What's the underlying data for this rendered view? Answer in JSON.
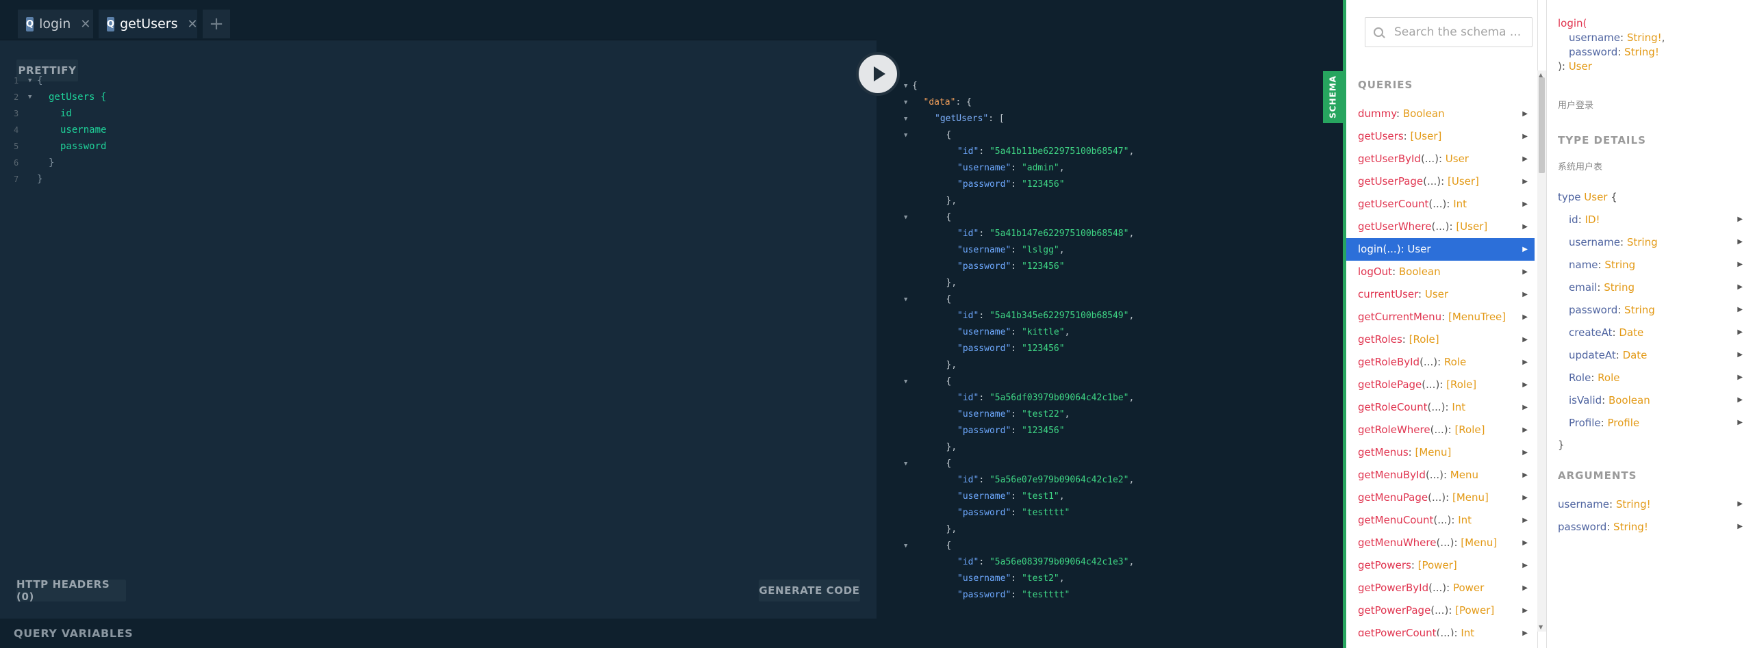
{
  "tabs": [
    {
      "icon": "Q",
      "label": "login",
      "close": "✕"
    },
    {
      "icon": "Q",
      "label": "getUsers",
      "close": "✕"
    }
  ],
  "add_tab": "+",
  "toolbar": {
    "prettify": "PRETTIFY",
    "http_headers": "HTTP HEADERS (0)",
    "generate_code": "GENERATE CODE"
  },
  "query_variables": "QUERY VARIABLES",
  "schema_tab": "SCHEMA",
  "editor": [
    {
      "n": "1",
      "fold": true,
      "text": "{",
      "indent": 0,
      "cls": "punc"
    },
    {
      "n": "2",
      "fold": true,
      "text": "getUsers {",
      "indent": 1,
      "cls": "kw-field"
    },
    {
      "n": "3",
      "fold": false,
      "text": "id",
      "indent": 2,
      "cls": "kw-field"
    },
    {
      "n": "4",
      "fold": false,
      "text": "username",
      "indent": 2,
      "cls": "kw-field"
    },
    {
      "n": "5",
      "fold": false,
      "text": "password",
      "indent": 2,
      "cls": "kw-field"
    },
    {
      "n": "6",
      "fold": false,
      "text": "}",
      "indent": 1,
      "cls": "punc"
    },
    {
      "n": "7",
      "fold": false,
      "text": "}",
      "indent": 0,
      "cls": "punc"
    }
  ],
  "result": {
    "data_key": "\"data\"",
    "list_key": "\"getUsers\"",
    "users": [
      {
        "id": "\"5a41b11be622975100b68547\"",
        "username": "\"admin\"",
        "password": "\"123456\""
      },
      {
        "id": "\"5a41b147e622975100b68548\"",
        "username": "\"lslgg\"",
        "password": "\"123456\""
      },
      {
        "id": "\"5a41b345e622975100b68549\"",
        "username": "\"kittle\"",
        "password": "\"123456\""
      },
      {
        "id": "\"5a56df03979b09064c42c1be\"",
        "username": "\"test22\"",
        "password": "\"123456\""
      },
      {
        "id": "\"5a56e07e979b09064c42c1e2\"",
        "username": "\"test1\"",
        "password": "\"testttt\""
      },
      {
        "id": "\"5a56e083979b09064c42c1e3\"",
        "username": "\"test2\"",
        "password": "\"testttt\""
      }
    ]
  },
  "docs": {
    "search_placeholder": "Search the schema ...",
    "queries_heading": "QUERIES",
    "queries": [
      {
        "name": "dummy",
        "args": "",
        "type": "Boolean"
      },
      {
        "name": "getUsers",
        "args": "",
        "type": "[User]"
      },
      {
        "name": "getUserById",
        "args": "(...)",
        "type": "User"
      },
      {
        "name": "getUserPage",
        "args": "(...)",
        "type": "[User]"
      },
      {
        "name": "getUserCount",
        "args": "(...)",
        "type": "Int"
      },
      {
        "name": "getUserWhere",
        "args": "(...)",
        "type": "[User]"
      },
      {
        "name": "login",
        "args": "(...)",
        "type": "User",
        "selected": true
      },
      {
        "name": "logOut",
        "args": "",
        "type": "Boolean"
      },
      {
        "name": "currentUser",
        "args": "",
        "type": "User"
      },
      {
        "name": "getCurrentMenu",
        "args": "",
        "type": "[MenuTree]"
      },
      {
        "name": "getRoles",
        "args": "",
        "type": "[Role]"
      },
      {
        "name": "getRoleById",
        "args": "(...)",
        "type": "Role"
      },
      {
        "name": "getRolePage",
        "args": "(...)",
        "type": "[Role]"
      },
      {
        "name": "getRoleCount",
        "args": "(...)",
        "type": "Int"
      },
      {
        "name": "getRoleWhere",
        "args": "(...)",
        "type": "[Role]"
      },
      {
        "name": "getMenus",
        "args": "",
        "type": "[Menu]"
      },
      {
        "name": "getMenuById",
        "args": "(...)",
        "type": "Menu"
      },
      {
        "name": "getMenuPage",
        "args": "(...)",
        "type": "[Menu]"
      },
      {
        "name": "getMenuCount",
        "args": "(...)",
        "type": "Int"
      },
      {
        "name": "getMenuWhere",
        "args": "(...)",
        "type": "[Menu]"
      },
      {
        "name": "getPowers",
        "args": "",
        "type": "[Power]"
      },
      {
        "name": "getPowerById",
        "args": "(...)",
        "type": "Power"
      },
      {
        "name": "getPowerPage",
        "args": "(...)",
        "type": "[Power]"
      },
      {
        "name": "getPowerCount",
        "args": "(...)",
        "type": "Int"
      }
    ],
    "detail": {
      "fn": "login(",
      "params": [
        {
          "name": "username",
          "type": "String!",
          "suffix": ","
        },
        {
          "name": "password",
          "type": "String!",
          "suffix": ""
        }
      ],
      "closing": "): ",
      "return_type": "User",
      "description": "用户登录",
      "type_details_heading": "TYPE DETAILS",
      "type_description": "系统用户表",
      "type_keyword": "type ",
      "type_name": "User",
      "type_open": " {",
      "type_close": "}",
      "fields": [
        {
          "name": "id",
          "type": "ID!"
        },
        {
          "name": "username",
          "type": "String"
        },
        {
          "name": "name",
          "type": "String"
        },
        {
          "name": "email",
          "type": "String"
        },
        {
          "name": "password",
          "type": "String"
        },
        {
          "name": "createAt",
          "type": "Date"
        },
        {
          "name": "updateAt",
          "type": "Date"
        },
        {
          "name": "Role",
          "type": "Role"
        },
        {
          "name": "isValid",
          "type": "Boolean"
        },
        {
          "name": "Profile",
          "type": "Profile"
        }
      ],
      "arguments_heading": "ARGUMENTS",
      "arguments": [
        {
          "name": "username",
          "type": "String!"
        },
        {
          "name": "password",
          "type": "String!"
        }
      ]
    }
  },
  "colors": {
    "accent_green": "#27a55f",
    "selected_blue": "#2c6fd9",
    "field_red": "#e0344f",
    "type_orange": "#e39a17"
  }
}
